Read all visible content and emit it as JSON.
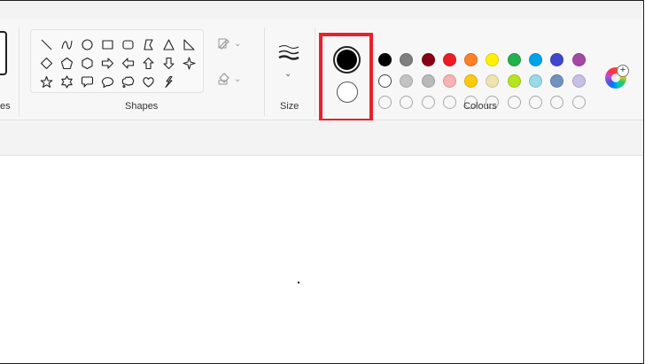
{
  "ribbon": {
    "groups": {
      "brushes_partial_label": "es",
      "shapes_label": "Shapes",
      "size_label": "Size",
      "colours_label": "Colours"
    },
    "shapes": [
      "line",
      "curve",
      "oval",
      "rectangle",
      "rounded-rectangle",
      "polygon",
      "triangle",
      "right-triangle",
      "diamond",
      "pentagon",
      "hexagon",
      "right-arrow",
      "left-arrow",
      "up-arrow",
      "down-arrow",
      "four-point-star",
      "five-point-star",
      "six-point-star",
      "rounded-rectangle-callout",
      "oval-callout",
      "cloud-callout",
      "heart",
      "lightning"
    ],
    "tools": {
      "outline": "outline-icon",
      "fill": "fill-icon"
    },
    "selected_colors": {
      "color1": "#000000",
      "color2": "#ffffff",
      "highlight": "#e8212a"
    },
    "palette": [
      "#000000",
      "#7f7f7f",
      "#880015",
      "#ed1c24",
      "#ff7f27",
      "#fff200",
      "#22b14c",
      "#00a2e8",
      "#3f48cc",
      "#a349a4",
      "#ffffff",
      "#c3c3c3",
      "#b9b9b9",
      "#f7b2b2",
      "#ffc90e",
      "#efe4b0",
      "#b5e61d",
      "#99d9ea",
      "#7092be",
      "#c8bfe7",
      "",
      "",
      "",
      "",
      "",
      "",
      "",
      "",
      "",
      ""
    ]
  }
}
